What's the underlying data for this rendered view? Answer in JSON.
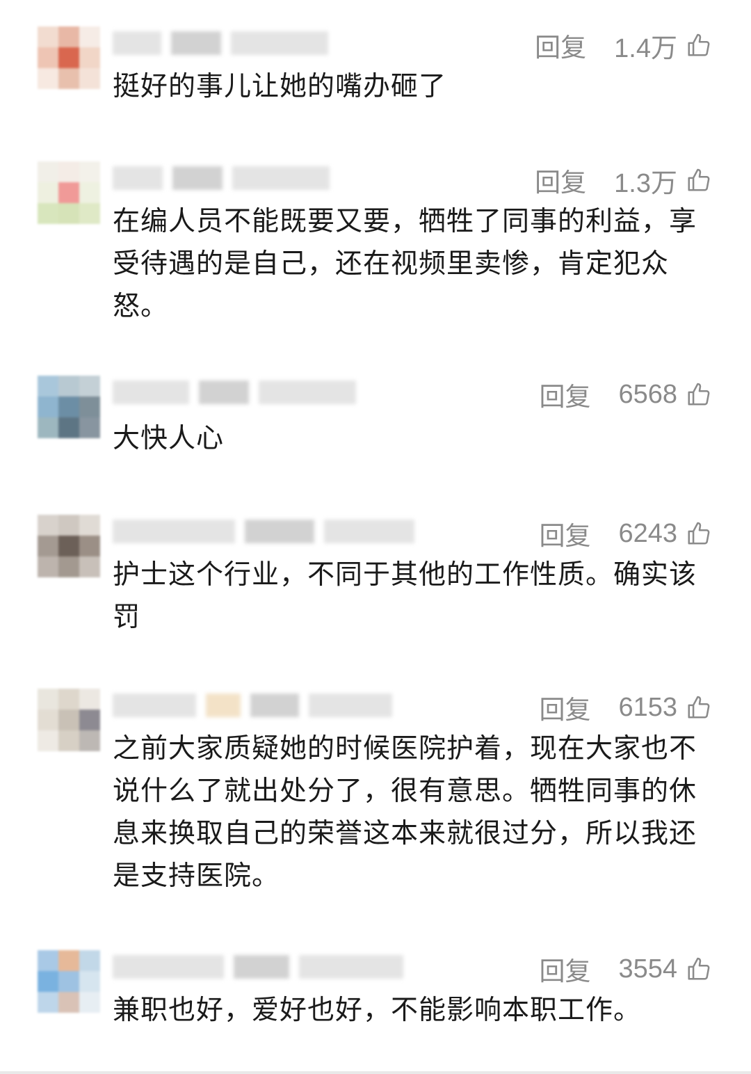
{
  "comments": [
    {
      "reply": "回复",
      "likes": "1.4万",
      "text": "挺好的事儿让她的嘴办砸了"
    },
    {
      "reply": "回复",
      "likes": "1.3万",
      "text": "在编人员不能既要又要，牺牲了同事的利益，享受待遇的是自己，还在视频里卖惨，肯定犯众怒。"
    },
    {
      "reply": "回复",
      "likes": "6568",
      "text": "大快人心"
    },
    {
      "reply": "回复",
      "likes": "6243",
      "text": "护士这个行业，不同于其他的工作性质。确实该罚"
    },
    {
      "reply": "回复",
      "likes": "6153",
      "text": "之前大家质疑她的时候医院护着，现在大家也不说什么了就出处分了，很有意思。牺牲同事的休息来换取自己的荣誉这本来就很过分，所以我还是支持医院。"
    },
    {
      "reply": "回复",
      "likes": "3554",
      "text": "兼职也好，爱好也好，不能影响本职工作。"
    }
  ],
  "icons": {
    "like": "thumbs-up-icon"
  },
  "colors": {
    "text": "#1a1a1a",
    "meta": "#8a8a8a",
    "background": "#ffffff"
  }
}
